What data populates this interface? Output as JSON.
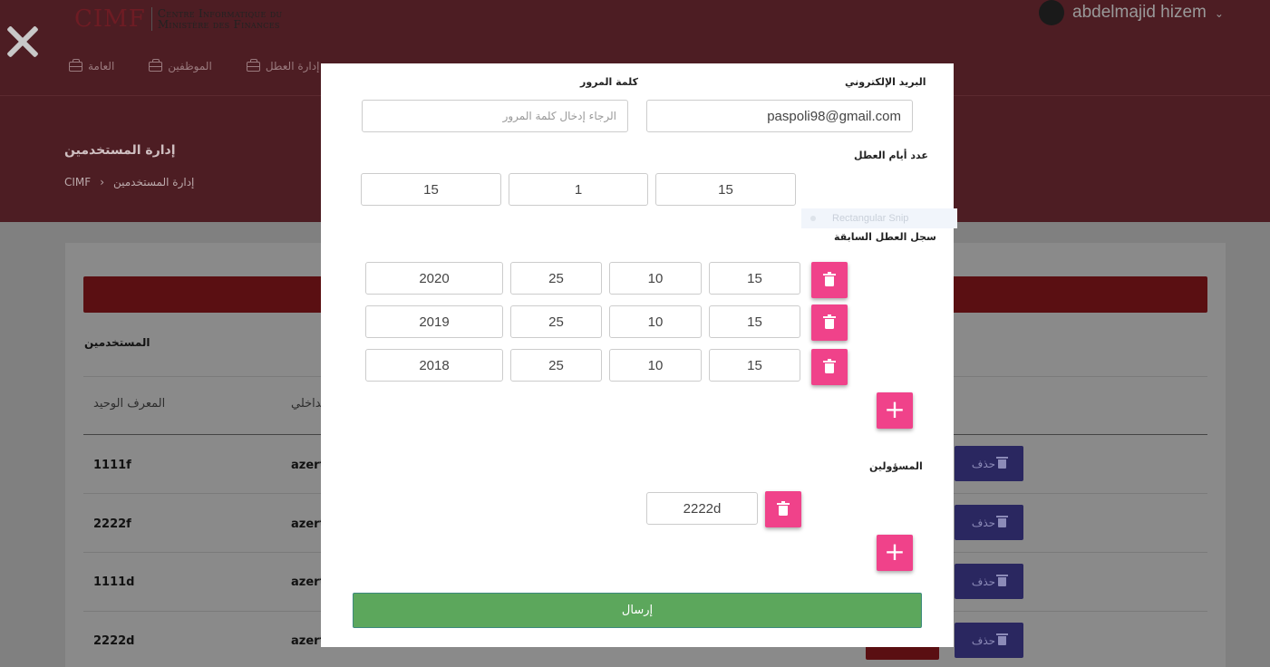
{
  "header": {
    "logo_mark": "CIMF",
    "logo_line1": "Centre Informatique du",
    "logo_line2": "Ministère des Finances",
    "user_name": "abdelmajid hizem",
    "nav": [
      "إدارة العطل",
      "الموظفين",
      "العامة"
    ]
  },
  "page": {
    "title": "إدارة المستخدمين",
    "breadcrumb_root": "CIMF",
    "breadcrumb_sep": "›",
    "breadcrumb_current": "إدارة المستخدمين"
  },
  "table": {
    "section_label": "المستخدمين",
    "col_id": "المعرف الوحيد",
    "col_password_partial": "الداخلي",
    "rows": [
      {
        "id": "1111f",
        "pass": "azerty"
      },
      {
        "id": "2222f",
        "pass": "azerty"
      },
      {
        "id": "1111d",
        "pass": "azerty"
      },
      {
        "id": "2222d",
        "pass": "azerty"
      }
    ],
    "delete_label": "حذف"
  },
  "modal": {
    "email_label": "البريد الإلكتروني",
    "email_value": "paspoli98@gmail.com",
    "password_label": "كلمة المرور",
    "password_placeholder": "الرجاء إدخال كلمة المرور",
    "leave_days_label": "عدد أيام العطل",
    "leave_days": [
      "15",
      "1",
      "15"
    ],
    "history_label": "سجل العطل السابقة",
    "history": [
      {
        "year": "2020",
        "a": "25",
        "b": "10",
        "c": "15"
      },
      {
        "year": "2019",
        "a": "25",
        "b": "10",
        "c": "15"
      },
      {
        "year": "2018",
        "a": "25",
        "b": "10",
        "c": "15"
      }
    ],
    "managers_label": "المسؤولين",
    "managers": [
      "2222d"
    ],
    "plus_symbol": "+",
    "submit_label": "إرسال"
  },
  "overlay": {
    "snip_label": "Rectangular Snip"
  },
  "colors": {
    "header_bg": "#4d1d23",
    "pink_button": "#f0428a",
    "submit_green": "#5ca75c",
    "delete_purple": "#2a2760"
  },
  "icons": [
    "close-icon",
    "briefcase-icon",
    "trash-icon",
    "plus-icon",
    "chevron-down-icon"
  ]
}
